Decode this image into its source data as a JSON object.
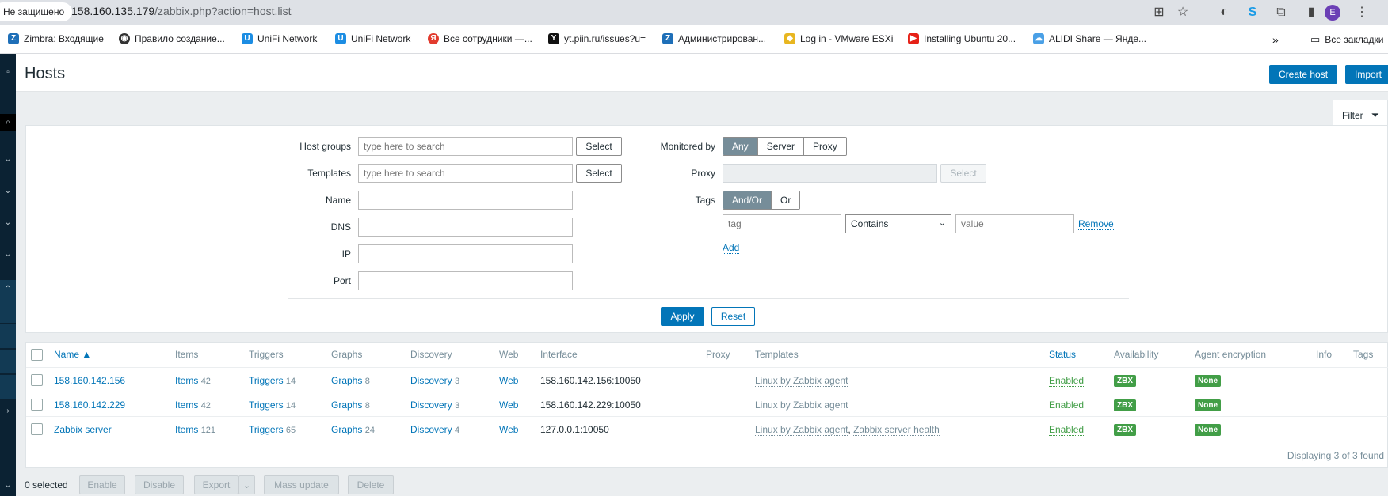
{
  "browser": {
    "security": "Не защищено",
    "url_host": "158.160.135.179",
    "url_path": "/zabbix.php?action=host.list",
    "avatar": "E"
  },
  "bookmarks": [
    {
      "label": "Zimbra: Входящие",
      "icon": "Z",
      "color": "#1e6fb8"
    },
    {
      "label": "Правило создание...",
      "icon": "◉",
      "color": "#333"
    },
    {
      "label": "UniFi Network",
      "icon": "U",
      "color": "#1c8de3"
    },
    {
      "label": "UniFi Network",
      "icon": "U",
      "color": "#1c8de3"
    },
    {
      "label": "Все сотрудники —...",
      "icon": "Я",
      "color": "#e23b2e"
    },
    {
      "label": "yt.piin.ru/issues?u=",
      "icon": "Y",
      "color": "#111"
    },
    {
      "label": "Администрирован...",
      "icon": "Z",
      "color": "#1e6fb8"
    },
    {
      "label": "Log in - VMware ESXi",
      "icon": "◆",
      "color": "#e8b620"
    },
    {
      "label": "Installing Ubuntu 20...",
      "icon": "▶",
      "color": "#e62117"
    },
    {
      "label": "ALIDI Share — Янде...",
      "icon": "☁",
      "color": "#4aa0e6"
    }
  ],
  "bookmarks_all": "Все закладки",
  "page": {
    "title": "Hosts",
    "create_host": "Create host",
    "import": "Import"
  },
  "filter": {
    "tab_label": "Filter",
    "host_groups_label": "Host groups",
    "host_groups_placeholder": "type here to search",
    "templates_label": "Templates",
    "templates_placeholder": "type here to search",
    "select": "Select",
    "name_label": "Name",
    "dns_label": "DNS",
    "ip_label": "IP",
    "port_label": "Port",
    "monitored_by_label": "Monitored by",
    "monitored_any": "Any",
    "monitored_server": "Server",
    "monitored_proxy": "Proxy",
    "proxy_label": "Proxy",
    "tags_label": "Tags",
    "tags_andor": "And/Or",
    "tags_or": "Or",
    "tag_placeholder": "tag",
    "tag_operator": "Contains",
    "tag_value_placeholder": "value",
    "remove": "Remove",
    "add": "Add",
    "apply": "Apply",
    "reset": "Reset"
  },
  "table": {
    "headers": {
      "name": "Name ▲",
      "items": "Items",
      "triggers": "Triggers",
      "graphs": "Graphs",
      "discovery": "Discovery",
      "web": "Web",
      "interface": "Interface",
      "proxy": "Proxy",
      "templates": "Templates",
      "status": "Status",
      "availability": "Availability",
      "agent_encryption": "Agent encryption",
      "info": "Info",
      "tags": "Tags"
    },
    "rows": [
      {
        "name": "158.160.142.156",
        "items": "Items",
        "items_count": "42",
        "triggers": "Triggers",
        "triggers_count": "14",
        "graphs": "Graphs",
        "graphs_count": "8",
        "discovery": "Discovery",
        "discovery_count": "3",
        "web": "Web",
        "interface": "158.160.142.156:10050",
        "template1": "Linux by Zabbix agent",
        "template2": "",
        "status": "Enabled",
        "availability": "ZBX",
        "encryption": "None"
      },
      {
        "name": "158.160.142.229",
        "items": "Items",
        "items_count": "42",
        "triggers": "Triggers",
        "triggers_count": "14",
        "graphs": "Graphs",
        "graphs_count": "8",
        "discovery": "Discovery",
        "discovery_count": "3",
        "web": "Web",
        "interface": "158.160.142.229:10050",
        "template1": "Linux by Zabbix agent",
        "template2": "",
        "status": "Enabled",
        "availability": "ZBX",
        "encryption": "None"
      },
      {
        "name": "Zabbix server",
        "items": "Items",
        "items_count": "121",
        "triggers": "Triggers",
        "triggers_count": "65",
        "graphs": "Graphs",
        "graphs_count": "24",
        "discovery": "Discovery",
        "discovery_count": "4",
        "web": "Web",
        "interface": "127.0.0.1:10050",
        "template1": "Linux by Zabbix agent",
        "template2": "Zabbix server health",
        "status": "Enabled",
        "availability": "ZBX",
        "encryption": "None"
      }
    ],
    "footer": "Displaying 3 of 3 found"
  },
  "bottom": {
    "selected": "0 selected",
    "enable": "Enable",
    "disable": "Disable",
    "export": "Export",
    "mass_update": "Mass update",
    "delete": "Delete"
  }
}
